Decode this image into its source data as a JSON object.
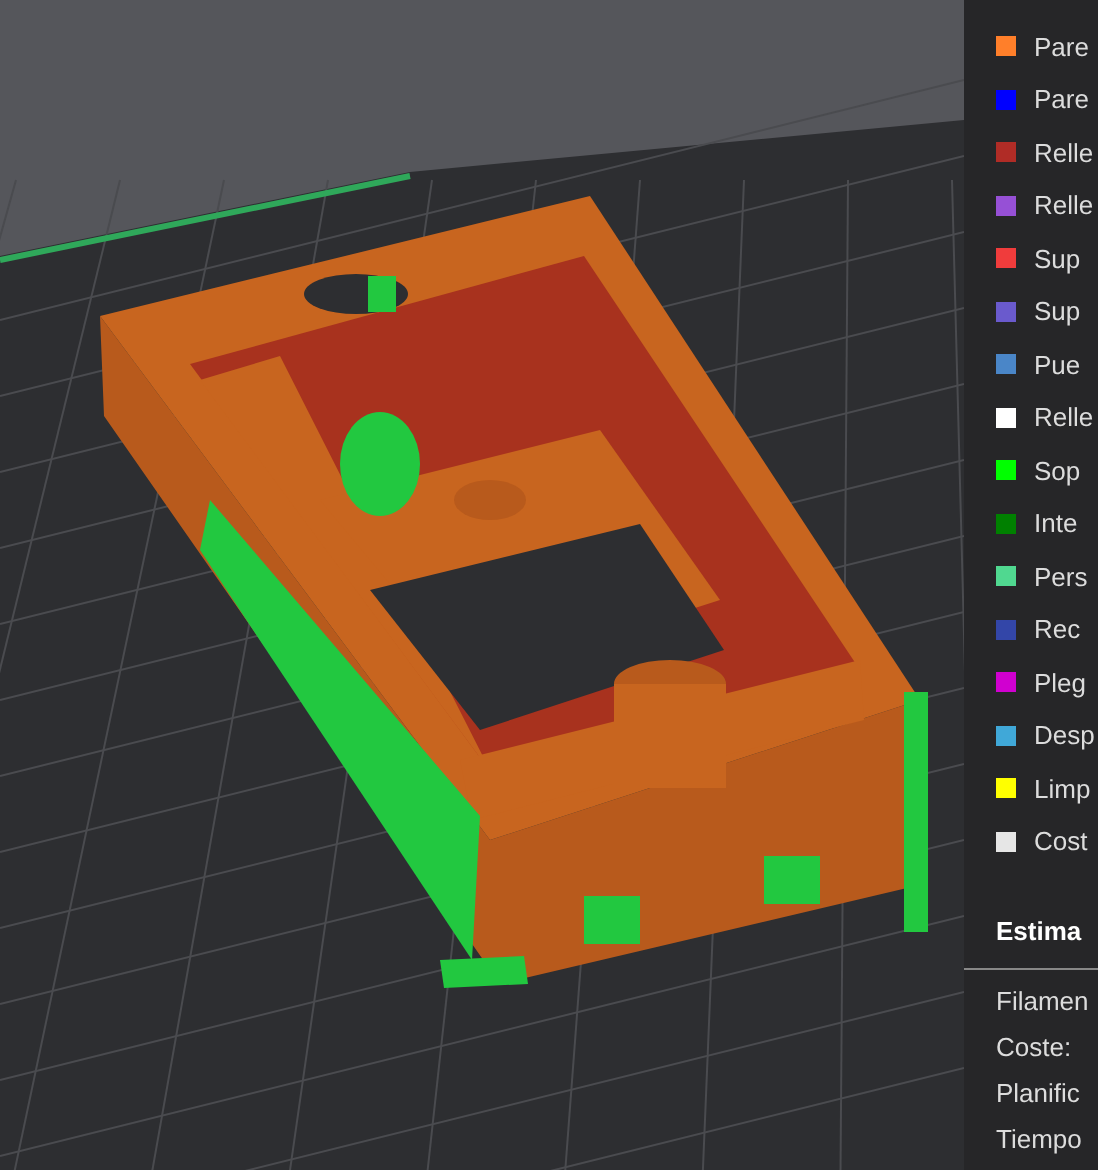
{
  "legend": {
    "items": [
      {
        "label": "Pare",
        "color": "#ff7f2a"
      },
      {
        "label": "Pare",
        "color": "#0000ff"
      },
      {
        "label": "Relle",
        "color": "#b02c26"
      },
      {
        "label": "Relle",
        "color": "#9650d6"
      },
      {
        "label": "Sup",
        "color": "#f03c3c"
      },
      {
        "label": "Sup",
        "color": "#6a5acd"
      },
      {
        "label": "Pue",
        "color": "#4a86c8"
      },
      {
        "label": "Relle",
        "color": "#ffffff"
      },
      {
        "label": "Sop",
        "color": "#00ff00"
      },
      {
        "label": "Inte",
        "color": "#008000"
      },
      {
        "label": "Pers",
        "color": "#50d890"
      },
      {
        "label": "Rec",
        "color": "#3346a8"
      },
      {
        "label": "Pleg",
        "color": "#d000d0"
      },
      {
        "label": "Desp",
        "color": "#40a8d8"
      },
      {
        "label": "Limp",
        "color": "#ffff00"
      },
      {
        "label": "Cost",
        "color": "#e6e6e6"
      }
    ]
  },
  "estimate": {
    "title": "Estima",
    "lines": [
      "Filamen",
      "Coste:",
      "Planific",
      "Tiempo"
    ]
  }
}
